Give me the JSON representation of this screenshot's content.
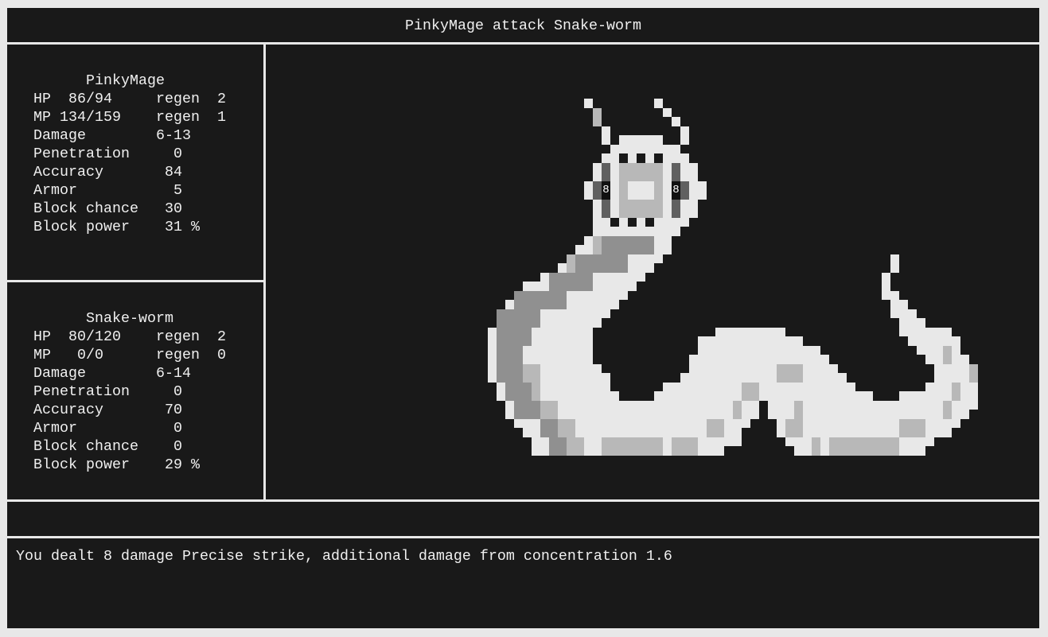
{
  "header": {
    "title": "PinkyMage attack Snake-worm"
  },
  "hero": {
    "name": "PinkyMage",
    "lines": [
      "HP  86/94     regen  2",
      "MP 134/159    regen  1",
      "Damage        6-13",
      "Penetration     0",
      "Accuracy       84",
      "Armor           5",
      "Block chance   30",
      "Block power    31 %"
    ]
  },
  "enemy": {
    "name": "Snake-worm",
    "lines": [
      "HP  80/120    regen  2",
      "MP   0/0      regen  0",
      "Damage        6-14",
      "Penetration     0",
      "Accuracy       70",
      "Armor           0",
      "Block chance    0",
      "Block power    29 %"
    ]
  },
  "scene": {
    "eye_left": "8",
    "eye_right": "8"
  },
  "action_bar": {},
  "log": {
    "message": "You dealt 8 damage Precise strike, additional damage from concentration 1.6"
  },
  "colors": {
    "background": "#e8e8e8",
    "panel": "#191919",
    "text": "#f0f0f0",
    "sprite_light": "#e8e8e8",
    "sprite_mid": "#b8b8b8",
    "sprite_gray": "#909090",
    "sprite_dark": "#606060"
  }
}
